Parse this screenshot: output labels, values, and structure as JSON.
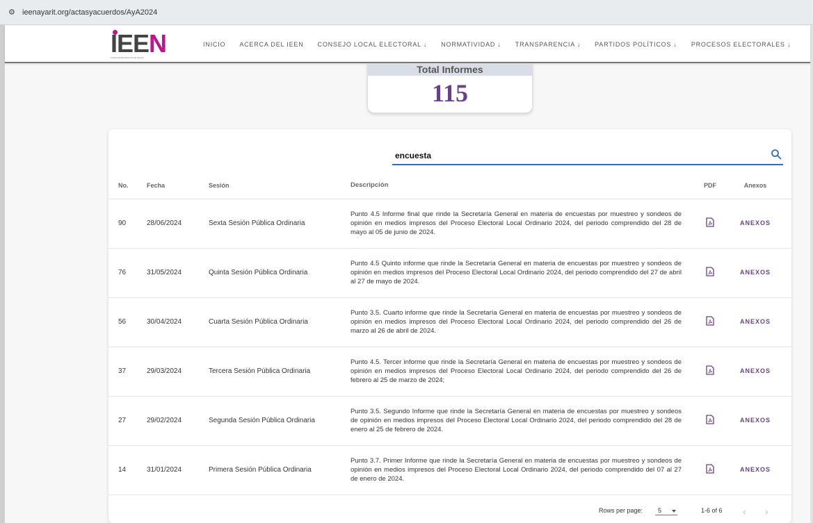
{
  "browser": {
    "url": "ieenayarit.org/actasyacuerdos/AyA2024"
  },
  "logo": {
    "text_main": "IEE",
    "text_accent": "N",
    "subtitle": "Instituto Estatal Electoral de Nayarit"
  },
  "menu": [
    {
      "label": "INICIO"
    },
    {
      "label": "ACERCA DEL IEEN"
    },
    {
      "label": "CONSEJO LOCAL ELECTORAL ↓"
    },
    {
      "label": "NORMATIVIDAD ↓"
    },
    {
      "label": "TRANSPARENCIA ↓"
    },
    {
      "label": "PARTIDOS POLÍTICOS ↓"
    },
    {
      "label": "PROCESOS ELECTORALES ↓"
    }
  ],
  "total": {
    "label": "Total Informes",
    "value": "115"
  },
  "search": {
    "value": "encuesta"
  },
  "table": {
    "headers": {
      "no": "No.",
      "fecha": "Fecha",
      "sesion": "Sesión",
      "descripcion": "Descripción",
      "pdf": "PDF",
      "anexos": "Anexos"
    },
    "anexos_label": "ANEXOS",
    "rows": [
      {
        "no": "90",
        "fecha": "28/06/2024",
        "sesion": "Sexta Sesión Pública Ordinaria",
        "descripcion": "Punto 4.5 Informe final que rinde la Secretaría General en materia de encuestas por muestreo y sondeos de opinión en medios impresos del Proceso Electoral Local Ordinario 2024, del periodo comprendido del 28 de mayo al 05 de junio de 2024."
      },
      {
        "no": "76",
        "fecha": "31/05/2024",
        "sesion": "Quinta Sesión Pública Ordinaria",
        "descripcion": "Punto 4.5 Quinto informe que rinde la Secretaría General en materia de encuestas por muestreo y sondeos de opinión en medios impresos del Proceso Electoral Local Ordinario 2024, del periodo comprendido del 27 de abril al 27 de mayo de 2024."
      },
      {
        "no": "56",
        "fecha": "30/04/2024",
        "sesion": "Cuarta Sesión Pública Ordinaria",
        "descripcion": "Punto 3.5. Cuarto informe que rinde la Secretaría General en materia de encuestas por muestreo y sondeos de opinión en medios impresos del Proceso Electoral Local Ordinario 2024, del periodo comprendido del 26 de marzo al 26 de abril de 2024."
      },
      {
        "no": "37",
        "fecha": "29/03/2024",
        "sesion": "Tercera Sesión Pública Ordinaria",
        "descripcion": "Punto 4.5. Tercer informe que rinde la Secretaría General en materia de encuestas por muestreo y sondeos de opinión en medios impresos del Proceso Electoral Local Ordinario 2024, del periodo comprendido del 26 de febrero al 25 de marzo de 2024;"
      },
      {
        "no": "27",
        "fecha": "29/02/2024",
        "sesion": "Segunda Sesión Pública Ordinaria",
        "descripcion": "Punto 3.5. Segundo Informe que rinde la Secretaría General en materia de encuestas por muestreo y sondeos de opinión en medios impresos del Proceso Electoral Local Ordinario 2024, del periodo comprendido del 28 de enero al 25 de febrero de 2024."
      },
      {
        "no": "14",
        "fecha": "31/01/2024",
        "sesion": "Primera Sesión Pública Ordinaria",
        "descripcion": "Punto 3.7. Primer Informe que rinde la Secretaría General en materia de encuestas por muestreo y sondeos de opinión en medios impresos del Proceso Electoral Local Ordinario 2024, del periodo comprendido del 07 al 27 de enero de 2024."
      }
    ]
  },
  "pagination": {
    "rows_per_page_label": "Rows per page:",
    "rows_per_page_value": "5",
    "range": "1-6 of 6",
    "prev": "‹",
    "next": "›"
  },
  "colors": {
    "accent_purple": "#6a3f8f",
    "logo_magenta": "#c0138f",
    "search_underline": "#2e6cc9"
  }
}
